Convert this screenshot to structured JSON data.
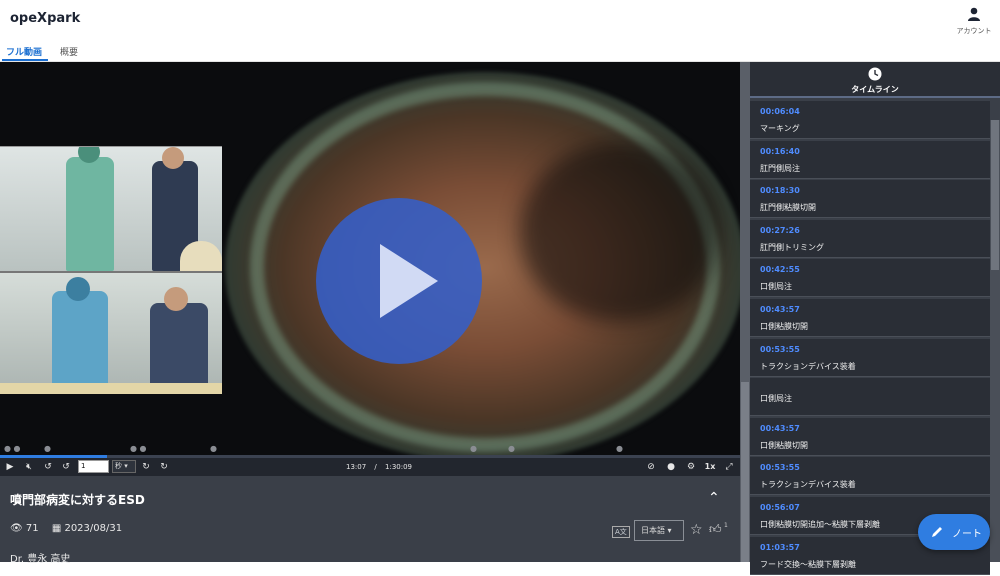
{
  "app": {
    "brand": "opeXpark",
    "account_label": "アカウント"
  },
  "tabs": [
    {
      "label": "フル動画",
      "active": true
    },
    {
      "label": "概要",
      "active": false
    }
  ],
  "player": {
    "seek_value": "1",
    "seek_unit": "秒",
    "current_time": "13:07",
    "separator": "/",
    "duration": "1:30:09",
    "speed": "1x",
    "progress_fraction": 0.145
  },
  "video_info": {
    "title": "噴門部病変に対するESD",
    "views": "71",
    "date": "2023/08/31",
    "author": "Dr. 豊永 高史",
    "language": "日本語",
    "like_count": "1"
  },
  "sidebar": {
    "title": "タイムライン",
    "items": [
      {
        "time": "00:06:04",
        "label": "マーキング"
      },
      {
        "time": "00:16:40",
        "label": "肛門側局注"
      },
      {
        "time": "00:18:30",
        "label": "肛門側粘膜切開"
      },
      {
        "time": "00:27:26",
        "label": "肛門側トリミング"
      },
      {
        "time": "00:42:55",
        "label": "口側局注"
      },
      {
        "time": "00:43:57",
        "label": "口側粘膜切開"
      },
      {
        "time": "00:53:55",
        "label": "トラクションデバイス装着"
      },
      {
        "time": "",
        "label": "口側局注"
      },
      {
        "time": "00:43:57",
        "label": "口側粘膜切開"
      },
      {
        "time": "00:53:55",
        "label": "トラクションデバイス装着"
      },
      {
        "time": "00:56:07",
        "label": "口側粘膜切開追加～粘膜下層剥離"
      },
      {
        "time": "01:03:57",
        "label": "フード交換～粘膜下層剥離"
      }
    ]
  },
  "note_button": {
    "label": "ノート"
  },
  "colors": {
    "accent": "#2f7de1",
    "timeline_time": "#4f8cff",
    "panel": "#3a3f48"
  }
}
